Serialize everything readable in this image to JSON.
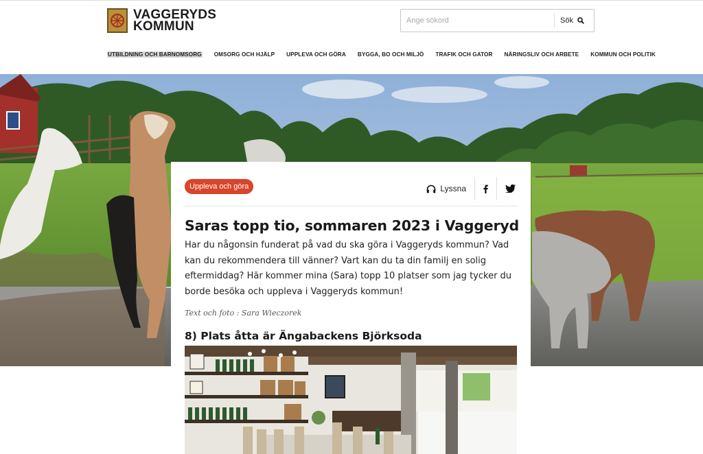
{
  "header": {
    "logo_line1": "VAGGERYDS",
    "logo_line2": "KOMMUN",
    "search_placeholder": "Ange sökord",
    "search_button": "Sök"
  },
  "nav": {
    "items": [
      {
        "label": "UTBILDNING OCH BARNOMSORG"
      },
      {
        "label": "OMSORG OCH HJÄLP"
      },
      {
        "label": "UPPLEVA OCH GÖRA"
      },
      {
        "label": "BYGGA, BO OCH MILJÖ"
      },
      {
        "label": "TRAFIK OCH GATOR"
      },
      {
        "label": "NÄRINGSLIV OCH ARBETE"
      },
      {
        "label": "KOMMUN OCH POLITIK"
      }
    ]
  },
  "article": {
    "tag": "Uppleva och göra",
    "listen": "Lyssna",
    "title": "Saras topp tio, sommaren 2023 i Vaggeryd",
    "lead": "Har du någonsin funderat på vad du ska göra i Vaggeryds kommun? Vad kan du rekommendera till vänner? Vart kan du ta din familj en solig eftermiddag? Här kommer mina (Sara) topp 10 platser som jag tycker du borde besöka och uppleva i Vaggeryds kommun!",
    "byline": "Text och foto : Sara Wieczorek",
    "section_heading": "8) Plats åtta är Ängabackens Björksoda"
  },
  "colors": {
    "tag_bg": "#d7452a",
    "brand_gold": "#b8913a"
  }
}
